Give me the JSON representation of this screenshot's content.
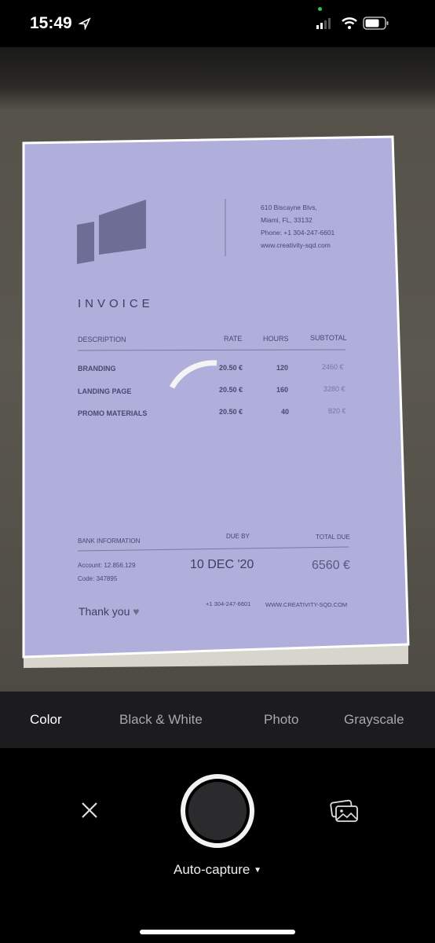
{
  "status_bar": {
    "time": "15:49",
    "location_icon": "location-arrow-icon",
    "signal_icon": "cellular-signal-icon",
    "wifi_icon": "wifi-icon",
    "battery_icon": "battery-icon"
  },
  "document": {
    "address": [
      "610 Biscayne Blvs,",
      "Miami, FL, 33132",
      "Phone: +1 304-247-6601",
      "www.creativity-sqd.com"
    ],
    "title": "INVOICE",
    "columns": [
      "DESCRIPTION",
      "RATE",
      "HOURS",
      "SUBTOTAL"
    ],
    "rows": [
      {
        "description": "BRANDING",
        "rate": "20.50 €",
        "hours": "120",
        "subtotal": "2460 €"
      },
      {
        "description": "LANDING PAGE",
        "rate": "20.50 €",
        "hours": "160",
        "subtotal": "3280 €"
      },
      {
        "description": "PROMO MATERIALS",
        "rate": "20.50 €",
        "hours": "40",
        "subtotal": "820 €"
      }
    ],
    "bank_label": "BANK INFORMATION",
    "due_by_label": "DUE BY",
    "total_due_label": "TOTAL DUE",
    "account": "Account: 12.856.129",
    "code": "Code: 347895",
    "due_date": "10 DEC '20",
    "total_due": "6560 €",
    "thank_you": "Thank you",
    "footer_phone": "+1 304-247-6601",
    "footer_web": "WWW.CREATIVITY-SQD.COM"
  },
  "detection_overlay_color": "#b0aedb",
  "filters": {
    "items": [
      "Color",
      "Black & White",
      "Photo",
      "Grayscale"
    ],
    "selected": "Color"
  },
  "controls": {
    "close_icon": "close-icon",
    "gallery_icon": "photo-gallery-icon",
    "mode_label": "Auto-capture",
    "mode_icon": "caret-down-icon"
  }
}
